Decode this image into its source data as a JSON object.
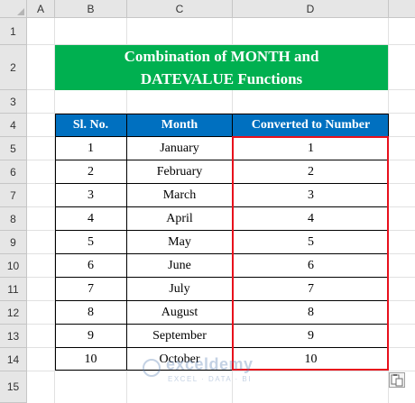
{
  "sheet": {
    "columns": [
      "A",
      "B",
      "C",
      "D"
    ],
    "rows": [
      "1",
      "2",
      "3",
      "4",
      "5",
      "6",
      "7",
      "8",
      "9",
      "10",
      "11",
      "12",
      "13",
      "14",
      "15"
    ]
  },
  "title": {
    "line1": "Combination of MONTH and",
    "line2": "DATEVALUE Functions"
  },
  "table": {
    "headers": [
      "Sl. No.",
      "Month",
      "Converted to Number"
    ],
    "rows": [
      {
        "sl": "1",
        "month": "January",
        "number": "1"
      },
      {
        "sl": "2",
        "month": "February",
        "number": "2"
      },
      {
        "sl": "3",
        "month": "March",
        "number": "3"
      },
      {
        "sl": "4",
        "month": "April",
        "number": "4"
      },
      {
        "sl": "5",
        "month": "May",
        "number": "5"
      },
      {
        "sl": "6",
        "month": "June",
        "number": "6"
      },
      {
        "sl": "7",
        "month": "July",
        "number": "7"
      },
      {
        "sl": "8",
        "month": "August",
        "number": "8"
      },
      {
        "sl": "9",
        "month": "September",
        "number": "9"
      },
      {
        "sl": "10",
        "month": "October",
        "number": "10"
      }
    ]
  },
  "watermark": {
    "name": "exceldemy",
    "tagline": "EXCEL · DATA · BI"
  },
  "colors": {
    "title_bg": "#00b050",
    "header_bg": "#0070c0",
    "highlight": "#e8101c"
  },
  "icons": {
    "paste_options": "paste-options-icon",
    "select_all": "select-all-corner"
  }
}
